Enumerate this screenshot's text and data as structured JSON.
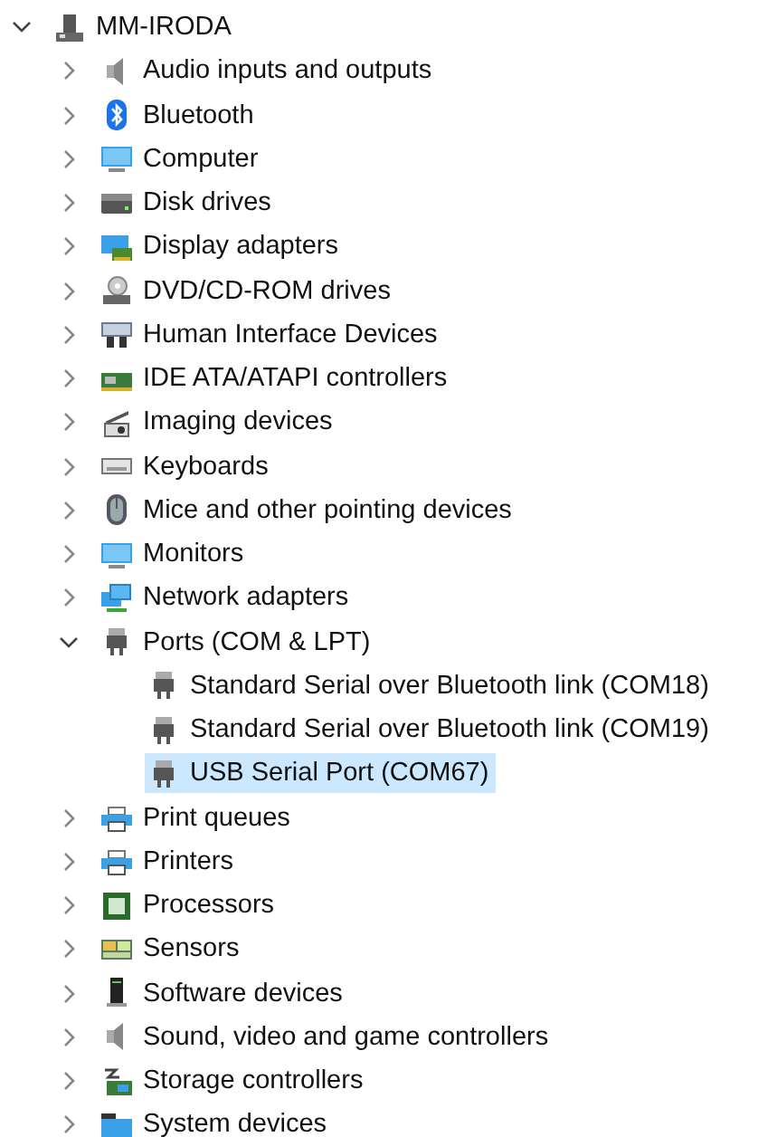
{
  "tree": {
    "label": "MM-IRODA",
    "expanded": true,
    "selected": false,
    "children": [
      {
        "label": "Audio inputs and outputs",
        "expanded": false,
        "selected": false
      },
      {
        "label": "Bluetooth",
        "expanded": false,
        "selected": false
      },
      {
        "label": "Computer",
        "expanded": false,
        "selected": false
      },
      {
        "label": "Disk drives",
        "expanded": false,
        "selected": false
      },
      {
        "label": "Display adapters",
        "expanded": false,
        "selected": false
      },
      {
        "label": "DVD/CD-ROM drives",
        "expanded": false,
        "selected": false
      },
      {
        "label": "Human Interface Devices",
        "expanded": false,
        "selected": false
      },
      {
        "label": "IDE ATA/ATAPI controllers",
        "expanded": false,
        "selected": false
      },
      {
        "label": "Imaging devices",
        "expanded": false,
        "selected": false
      },
      {
        "label": "Keyboards",
        "expanded": false,
        "selected": false
      },
      {
        "label": "Mice and other pointing devices",
        "expanded": false,
        "selected": false
      },
      {
        "label": "Monitors",
        "expanded": false,
        "selected": false
      },
      {
        "label": "Network adapters",
        "expanded": false,
        "selected": false
      },
      {
        "label": "Ports (COM & LPT)",
        "expanded": true,
        "selected": false,
        "children": [
          {
            "label": "Standard Serial over Bluetooth link (COM18)",
            "selected": false
          },
          {
            "label": "Standard Serial over Bluetooth link (COM19)",
            "selected": false
          },
          {
            "label": "USB Serial Port (COM67)",
            "selected": true
          }
        ]
      },
      {
        "label": "Print queues",
        "expanded": false,
        "selected": false
      },
      {
        "label": "Printers",
        "expanded": false,
        "selected": false
      },
      {
        "label": "Processors",
        "expanded": false,
        "selected": false
      },
      {
        "label": "Sensors",
        "expanded": false,
        "selected": false
      },
      {
        "label": "Software devices",
        "expanded": false,
        "selected": false
      },
      {
        "label": "Sound, video and game controllers",
        "expanded": false,
        "selected": false
      },
      {
        "label": "Storage controllers",
        "expanded": false,
        "selected": false
      },
      {
        "label": "System devices",
        "expanded": false,
        "selected": false
      }
    ]
  }
}
